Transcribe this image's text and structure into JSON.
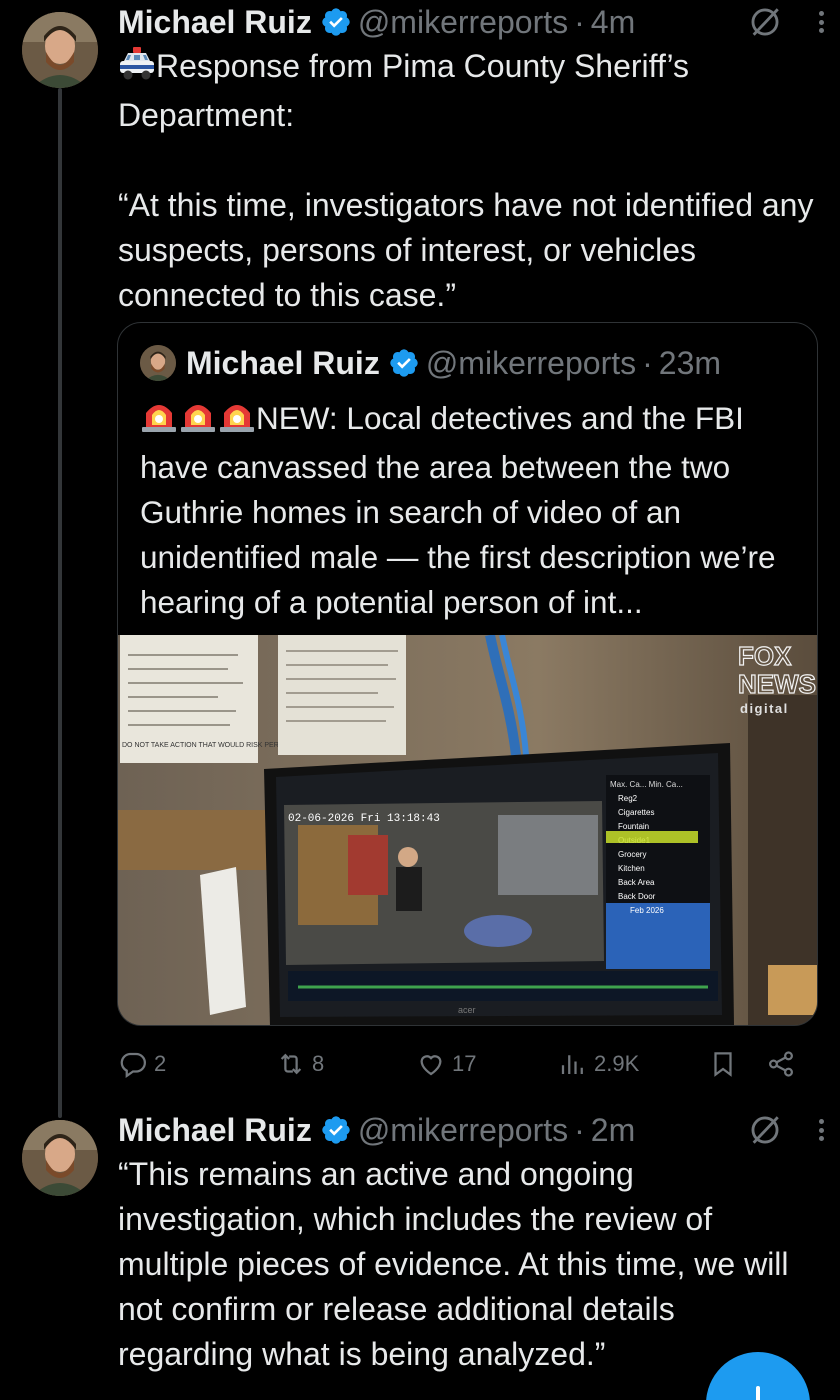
{
  "tweet1": {
    "name": "Michael Ruiz",
    "handle": "@mikerreports",
    "sep": "·",
    "time": "4m",
    "text": "Response from Pima County Sheriff’s Department:\n\n“At this time, investigators have not identified any suspects, persons of interest, or vehicles connected to this case.”",
    "emoji_icon": "police-car-icon"
  },
  "quote": {
    "name": "Michael Ruiz",
    "handle": "@mikerreports",
    "sep": "·",
    "time": "23m",
    "text": "NEW: Local detectives and the FBI have canvassed the area between the two Guthrie homes in search of video of an unidentified male — the first description we’re hearing of a potential person of int...",
    "emoji_icon": "siren-icon",
    "image": {
      "watermark_line1": "FOX",
      "watermark_line2": "NEWS",
      "watermark_line3": "digital",
      "sign_text": "DO NOT TAKE ACTION THAT WOULD RISK PERSONAL SAFETY",
      "monitor_timestamp": "02-06-2026 Fri 13:18:43",
      "camera_list": [
        "Reg2",
        "Cigarettes",
        "Fountain",
        "Outside1",
        "Grocery",
        "Kitchen",
        "Back Area",
        "Back Door"
      ],
      "camera_header": "Max. Ca...  Min. Ca...",
      "calendar_label": "Feb 2026",
      "monitor_brand": "acer"
    }
  },
  "actions": {
    "replies": "2",
    "reposts": "8",
    "likes": "17",
    "views": "2.9K"
  },
  "tweet2": {
    "name": "Michael Ruiz",
    "handle": "@mikerreports",
    "sep": "·",
    "time": "2m",
    "text": "“This remains an active and ongoing investigation, which includes the review of multiple pieces of evidence. At this time, we will not confirm or release additional details regarding what is being analyzed.”"
  },
  "colors": {
    "background": "#000000",
    "text": "#e7e9ea",
    "secondary": "#71767b",
    "accent": "#1d9bf0",
    "border": "#2f3336"
  }
}
